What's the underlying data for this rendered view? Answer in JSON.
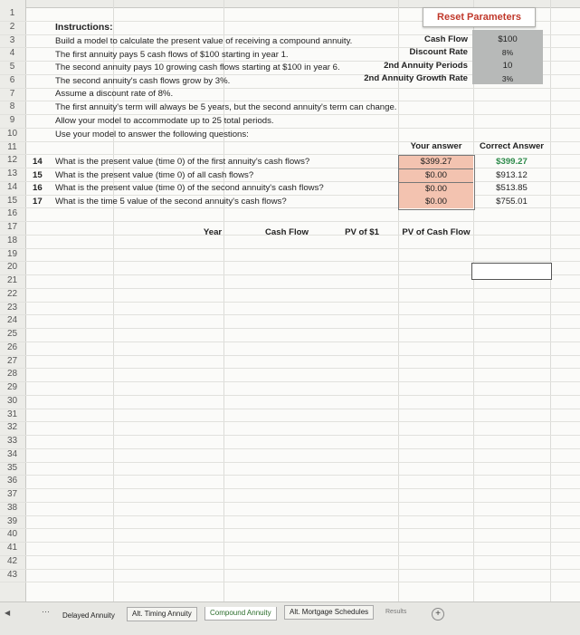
{
  "row_numbers": [
    "1",
    "2",
    "3",
    "4",
    "5",
    "6",
    "7",
    "8",
    "9",
    "10",
    "11",
    "12",
    "13",
    "14",
    "15",
    "16",
    "17",
    "18",
    "19",
    "20",
    "21",
    "22",
    "23",
    "24",
    "25",
    "26",
    "27",
    "28",
    "29",
    "30",
    "31",
    "32",
    "33",
    "34",
    "35",
    "36",
    "37",
    "38",
    "39",
    "40",
    "41",
    "42",
    "43"
  ],
  "reset_button": "Reset Parameters",
  "instructions": {
    "title": "Instructions:",
    "lines": [
      "Build a model to calculate the present value of receiving a compound annuity.",
      "The first annuity pays 5 cash flows of $100 starting in year 1.",
      "The second annuity pays 10 growing cash flows starting at $100 in year 6.",
      "The second annuity's cash flows grow by 3%.",
      "Assume a discount rate of 8%.",
      "The first annuity's term will always be 5 years, but the second annuity's term can change.",
      "Allow your model to accommodate up to 25 total periods.",
      "Use your model to answer the following questions:"
    ]
  },
  "parameters": [
    {
      "label": "Cash Flow",
      "value": "$100"
    },
    {
      "label": "Discount Rate",
      "value": "8%"
    },
    {
      "label": "2nd Annuity Periods",
      "value": "10"
    },
    {
      "label": "2nd Annuity Growth Rate",
      "value": "3%"
    }
  ],
  "answers_header": {
    "your_answer": "Your answer",
    "correct_answer": "Correct Answer"
  },
  "questions": [
    {
      "num": "14",
      "text": "What is the present value (time 0) of the first annuity's cash flows?",
      "your_answer": "$399.27",
      "correct": "$399.27"
    },
    {
      "num": "15",
      "text": "What is the present value (time 0) of all cash flows?",
      "your_answer": "$0.00",
      "correct": "$913.12"
    },
    {
      "num": "16",
      "text": "What is the present value (time 0) of the second annuity's cash flows?",
      "your_answer": "$0.00",
      "correct": "$513.85"
    },
    {
      "num": "17",
      "text": "What is the time 5 value of the second annuity's cash flows?",
      "your_answer": "$0.00",
      "correct": "$755.01"
    }
  ],
  "table_headers": {
    "year": "Year",
    "cash_flow": "Cash Flow",
    "pv_of_1": "PV of $1",
    "pv_of_cash_flow": "PV of Cash Flow"
  },
  "tabs": [
    {
      "label": "Delayed Annuity"
    },
    {
      "label": "Alt. Timing Annuity"
    },
    {
      "label": "Compound Annuity"
    },
    {
      "label": "Alt. Mortgage Schedules"
    },
    {
      "label": "Results"
    }
  ],
  "colors": {
    "reset_text": "#c0382b",
    "answer_fill": "#f3c3b0",
    "param_fill": "#b7b9b8",
    "correct_green": "#2e8b4b"
  }
}
